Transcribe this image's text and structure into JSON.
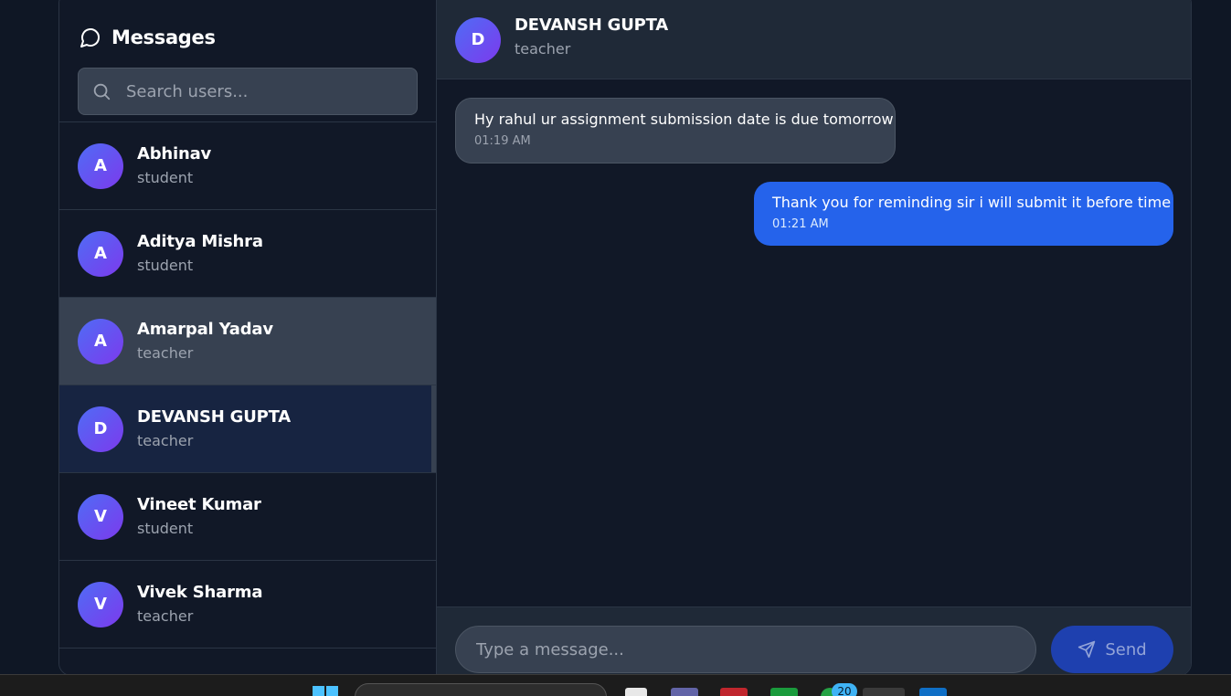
{
  "sidebar": {
    "title": "Messages",
    "search_placeholder": "Search users...",
    "users": [
      {
        "initial": "A",
        "name": "Abhinav",
        "role": "student"
      },
      {
        "initial": "A",
        "name": "Aditya Mishra",
        "role": "student"
      },
      {
        "initial": "A",
        "name": "Amarpal Yadav",
        "role": "teacher"
      },
      {
        "initial": "D",
        "name": "DEVANSH GUPTA",
        "role": "teacher"
      },
      {
        "initial": "V",
        "name": "Vineet Kumar",
        "role": "student"
      },
      {
        "initial": "V",
        "name": "Vivek Sharma",
        "role": "teacher"
      }
    ]
  },
  "chat": {
    "header": {
      "initial": "D",
      "name": "DEVANSH GUPTA",
      "role": "teacher"
    },
    "messages": [
      {
        "direction": "incoming",
        "text": "Hy rahul ur assignment submission date is due tomorrow",
        "time": "01:19 AM"
      },
      {
        "direction": "outgoing",
        "text": "Thank you for reminding sir i will submit it before time",
        "time": "01:21 AM"
      }
    ],
    "composer": {
      "placeholder": "Type a message...",
      "send_label": "Send"
    }
  },
  "taskbar": {
    "notification_count": "20"
  },
  "colors": {
    "background": "#0f1725",
    "panel": "#111827",
    "header": "#1f2937",
    "accent": "#2563eb",
    "active_item": "#172441",
    "hover_item": "#374151"
  }
}
